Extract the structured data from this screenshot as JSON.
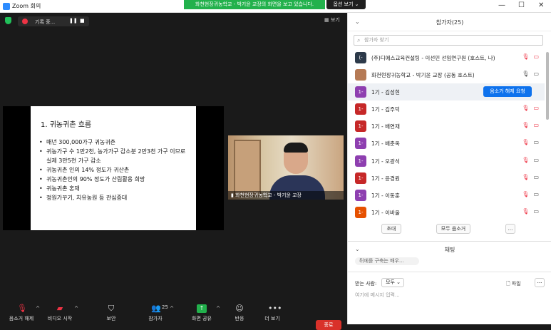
{
  "window": {
    "title": "Zoom 회의",
    "share_banner": "화천현장귀농학교 - 박기윤 교장의 화면을 보고 있습니다.",
    "view_options": "옵션 보기 ⌄",
    "minimize": "—",
    "maximize": "☐",
    "close": "✕"
  },
  "meeting": {
    "recording_label": "기록 중...",
    "view_label": "보기",
    "slide": {
      "title": "1. 귀농귀촌 흐름",
      "bullets": [
        "매년 300,000가구 귀농귀촌",
        "귀농가구 수 1만2천, 농가가구 감소분 2만3천 가구 이므로 실제 3만5천 가구 감소",
        "귀농귀촌 인의 14% 정도가 귀산촌",
        "귀농귀촌인의 90% 정도가 산림활용 희망",
        "귀농귀촌 혼재",
        "정원가꾸기, 치유농원 등 관심증대"
      ]
    },
    "video_name": "화천현장귀농학교 - 박기윤 교장",
    "toolbar": {
      "unmute": "음소거 해제",
      "start_video": "비디오 시작",
      "security": "보안",
      "participants": "참가자",
      "participants_count": "25",
      "share_screen": "화면 공유",
      "reactions": "반응",
      "more": "더 보기",
      "end": "종료"
    }
  },
  "participants_panel": {
    "title": "참가자(25)",
    "search_placeholder": "참가자 찾기",
    "rows": [
      {
        "avatar": "(-",
        "color": "#2d3a4a",
        "name": "(주)디에스교육컨설팅 - 이선민 선임연구원 (호스트, 나)",
        "cam_red": true
      },
      {
        "avatar": "",
        "color": "#b57a55",
        "name": "화천현장귀농학교 - 박기윤 교장 (공동 호스트)",
        "cam_red": false
      },
      {
        "avatar": "1-",
        "color": "#8e3fb0",
        "name": "1기 - 김성현",
        "cam_red": false
      },
      {
        "avatar": "1-",
        "color": "#c62828",
        "name": "1기 - 김주덕",
        "cam_red": true
      },
      {
        "avatar": "1-",
        "color": "#c62828",
        "name": "1기 - 배연재",
        "cam_red": true
      },
      {
        "avatar": "1-",
        "color": "#8e3fb0",
        "name": "1기 - 배춘옥",
        "cam_red": false
      },
      {
        "avatar": "1-",
        "color": "#8e3fb0",
        "name": "1기 - 오광석",
        "cam_red": false
      },
      {
        "avatar": "1-",
        "color": "#c62828",
        "name": "1기 - 윤경원",
        "cam_red": false
      },
      {
        "avatar": "1-",
        "color": "#8e3fb0",
        "name": "1기 - 이동훈",
        "cam_red": false
      },
      {
        "avatar": "1-",
        "color": "#e65100",
        "name": "1기 - 이바울",
        "cam_red": false
      }
    ],
    "unmute_request": "음소거 해제 요청",
    "invite": "초대",
    "mute_all": "모두 음소거",
    "more": "..."
  },
  "chat_panel": {
    "title": "채팅",
    "partial_message": "뒤에를 구축는 배우...",
    "to_label": "받는 사람:",
    "to_value": "모두 ⌄",
    "file_label": "파일",
    "more": "...",
    "input_placeholder": "여기에 메시지 입력..."
  }
}
